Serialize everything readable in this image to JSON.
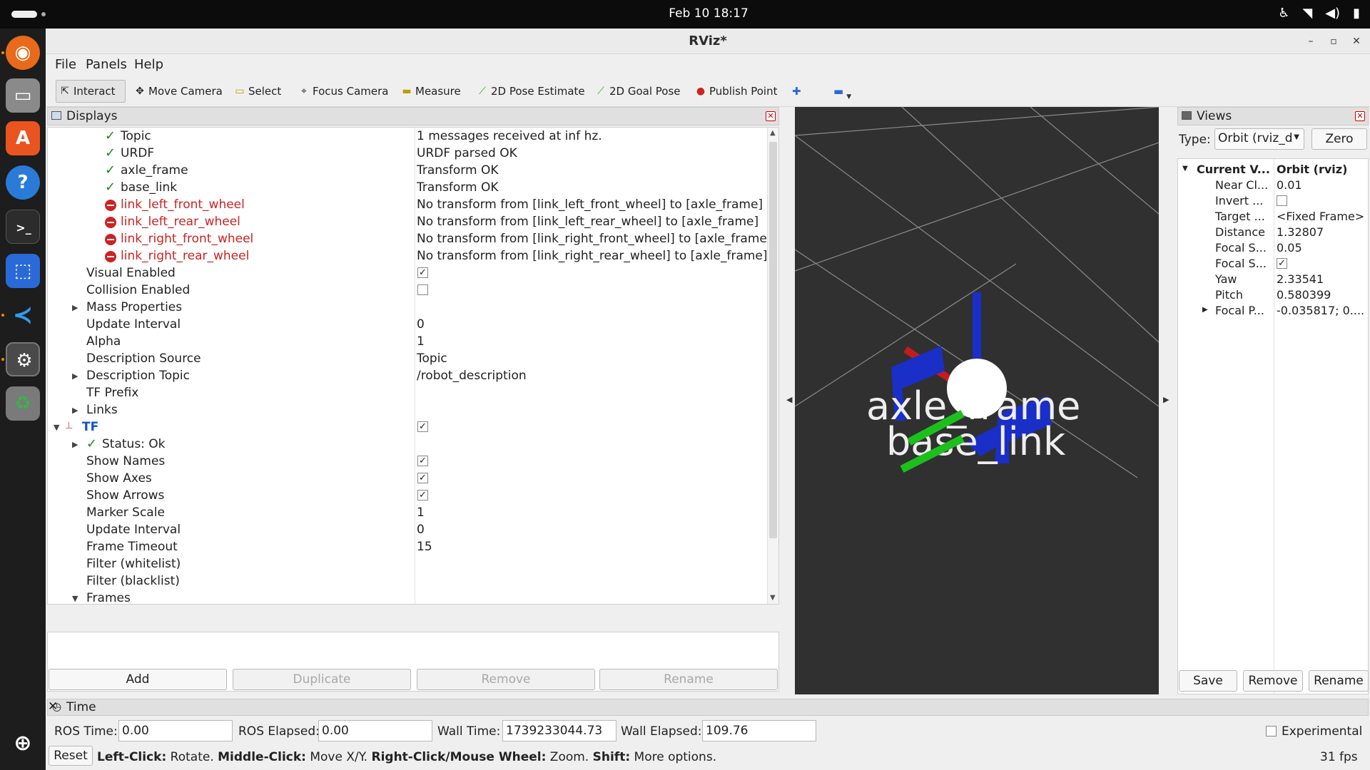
{
  "topbar": {
    "clock": "Feb 10  18:17"
  },
  "window": {
    "title": "RViz*"
  },
  "menu": {
    "file": "File",
    "panels": "Panels",
    "help": "Help"
  },
  "toolbar": {
    "interact": "Interact",
    "move_camera": "Move Camera",
    "select": "Select",
    "focus_camera": "Focus Camera",
    "measure": "Measure",
    "pose_estimate": "2D Pose Estimate",
    "goal_pose": "2D Goal Pose",
    "publish_point": "Publish Point",
    "plus": "✚",
    "minus": "▬"
  },
  "displays": {
    "title": "Displays",
    "rows": [
      {
        "name": "Topic",
        "value": "1 messages received at inf hz."
      },
      {
        "name": "URDF",
        "value": "URDF parsed OK"
      },
      {
        "name": "axle_frame",
        "value": "Transform OK"
      },
      {
        "name": "base_link",
        "value": "Transform OK"
      },
      {
        "name": "link_left_front_wheel",
        "value": "No transform from [link_left_front_wheel] to [axle_frame]"
      },
      {
        "name": "link_left_rear_wheel",
        "value": "No transform from [link_left_rear_wheel] to [axle_frame]"
      },
      {
        "name": "link_right_front_wheel",
        "value": "No transform from [link_right_front_wheel] to [axle_frame]"
      },
      {
        "name": "link_right_rear_wheel",
        "value": "No transform from [link_right_rear_wheel] to [axle_frame]"
      },
      {
        "name": "Visual Enabled",
        "checked": true
      },
      {
        "name": "Collision Enabled",
        "checked": false
      },
      {
        "name": "Mass Properties"
      },
      {
        "name": "Update Interval",
        "value": "0"
      },
      {
        "name": "Alpha",
        "value": "1"
      },
      {
        "name": "Description Source",
        "value": "Topic"
      },
      {
        "name": "Description Topic",
        "value": "/robot_description"
      },
      {
        "name": "TF Prefix"
      },
      {
        "name": "Links"
      },
      {
        "name": "TF",
        "checked": true
      },
      {
        "name": "Status: Ok"
      },
      {
        "name": "Show Names",
        "checked": true
      },
      {
        "name": "Show Axes",
        "checked": true
      },
      {
        "name": "Show Arrows",
        "checked": true
      },
      {
        "name": "Marker Scale",
        "value": "1"
      },
      {
        "name": "Update Interval",
        "value": "0"
      },
      {
        "name": "Frame Timeout",
        "value": "15"
      },
      {
        "name": "Filter (whitelist)"
      },
      {
        "name": "Filter (blacklist)"
      },
      {
        "name": "Frames"
      }
    ],
    "buttons": {
      "add": "Add",
      "duplicate": "Duplicate",
      "remove": "Remove",
      "rename": "Rename"
    }
  },
  "viewport": {
    "label_axle": "axle_frame",
    "label_base": "base_link"
  },
  "views": {
    "title": "Views",
    "type_label": "Type:",
    "type_value": "Orbit (rviz_d",
    "zero": "Zero",
    "header": {
      "key": "Current V...",
      "value": "Orbit (rviz)"
    },
    "rows": [
      {
        "key": "Near Cl...",
        "value": "0.01"
      },
      {
        "key": "Invert ...",
        "checked": false
      },
      {
        "key": "Target ...",
        "value": "<Fixed Frame>"
      },
      {
        "key": "Distance",
        "value": "1.32807"
      },
      {
        "key": "Focal S...",
        "value": "0.05"
      },
      {
        "key": "Focal S...",
        "checked": true
      },
      {
        "key": "Yaw",
        "value": "2.33541"
      },
      {
        "key": "Pitch",
        "value": "0.580399"
      },
      {
        "key": "Focal P...",
        "value": "-0.035817; 0...."
      }
    ],
    "buttons": {
      "save": "Save",
      "remove": "Remove",
      "rename": "Rename"
    }
  },
  "time": {
    "title": "Time",
    "ros_time_label": "ROS Time:",
    "ros_time": "0.00",
    "ros_elapsed_label": "ROS Elapsed:",
    "ros_elapsed": "0.00",
    "wall_time_label": "Wall Time:",
    "wall_time": "1739233044.73",
    "wall_elapsed_label": "Wall Elapsed:",
    "wall_elapsed": "109.76",
    "experimental": "Experimental"
  },
  "status": {
    "reset": "Reset",
    "lc": "Left-Click:",
    "lc_t": " Rotate. ",
    "mc": "Middle-Click:",
    "mc_t": " Move X/Y. ",
    "rc": "Right-Click/Mouse Wheel:",
    "rc_t": " Zoom. ",
    "sh": "Shift:",
    "sh_t": " More options.",
    "fps": "31 fps"
  },
  "colors": {
    "error": "#cc2222",
    "ok": "#1a8a1a",
    "tf": "#1452c8",
    "viewport_bg": "#303030"
  }
}
